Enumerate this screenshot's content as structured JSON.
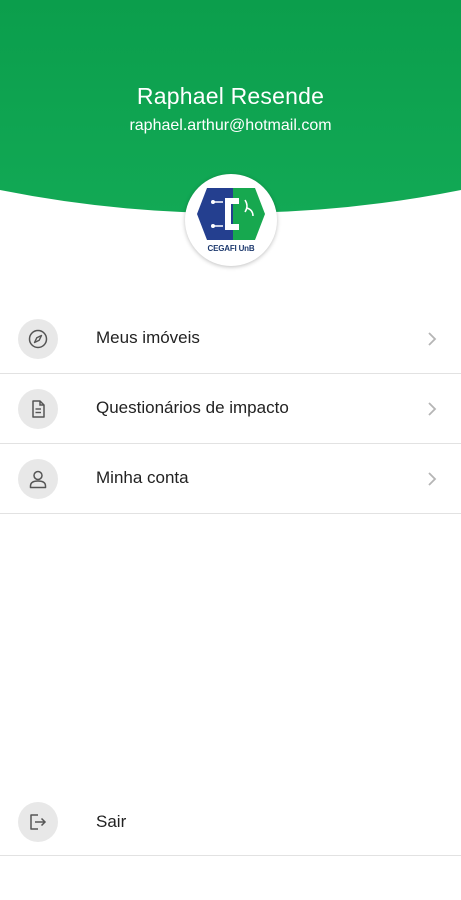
{
  "header": {
    "name": "Raphael Resende",
    "email": "raphael.arthur@hotmail.com",
    "logo_text": "CEGAFI UnB",
    "background_color": "#0ea24f"
  },
  "menu": {
    "items": [
      {
        "label": "Meus imóveis",
        "icon": "compass-icon"
      },
      {
        "label": "Questionários de impacto",
        "icon": "document-icon"
      },
      {
        "label": "Minha conta",
        "icon": "user-icon"
      }
    ]
  },
  "logout": {
    "label": "Sair",
    "icon": "logout-icon"
  }
}
